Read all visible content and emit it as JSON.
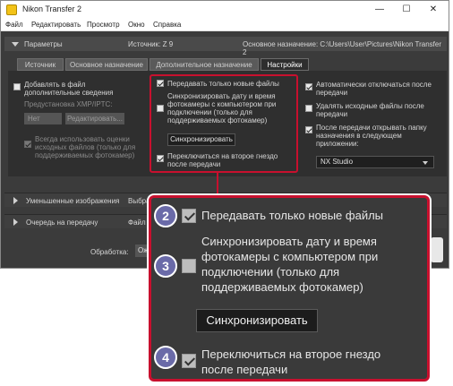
{
  "window": {
    "title": "Nikon Transfer 2",
    "minimize": "—",
    "maximize": "☐",
    "close": "✕"
  },
  "menu": [
    "Файл",
    "Редактировать",
    "Просмотр",
    "Окно",
    "Справка"
  ],
  "params": {
    "label": "Параметры",
    "source": "Источник: Z 9",
    "destination": "Основное назначение: C:\\Users\\User\\Pictures\\Nikon Transfer 2"
  },
  "tabs": [
    "Источник",
    "Основное назначение",
    "Дополнительное назначение",
    "Настройки"
  ],
  "settings": {
    "add_info": "Добавлять в файл дополнительные сведения",
    "xmp_preset": "Предустановка XMP/IPTC:",
    "xmp_value": "Нет",
    "edit_button": "Редактировать...",
    "always_use_rating": "Всегда использовать оценки исходных файлов (только для поддерживаемых фотокамер)",
    "only_new": "Передавать только новые файлы",
    "sync_datetime": "Синхронизировать дату и время фотокамеры с компьютером при подключении (только для поддерживаемых фотокамер)",
    "sync_button": "Синхронизировать",
    "switch_slot": "Переключиться на второе гнездо после передачи",
    "auto_disconnect": "Автоматически отключаться после передачи",
    "delete_originals": "Удалять исходные файлы после передачи",
    "open_folder": "После передачи открывать папку назначения в следующем приложении:",
    "app_value": "NX Studio"
  },
  "sections": {
    "thumbnails": "Уменьшенные изображения",
    "thumbnails_tail": "Выбра",
    "queue": "Очередь на передачу",
    "queue_tail": "Файл"
  },
  "processing": {
    "label": "Обработка:",
    "value": "Ож"
  },
  "callouts": {
    "badge2": "2",
    "badge3": "3",
    "badge4": "4",
    "only_new": "Передавать только новые файлы",
    "sync_datetime": "Синхронизировать дату и время фотокамеры с компьютером при подключении (только для поддерживаемых фотокамер)",
    "sync_button": "Синхронизировать",
    "switch_slot": "Переключиться на второе гнездо после передачи"
  },
  "colors": {
    "highlight": "#c8102e",
    "badge": "#6a6aa8",
    "panel_bg": "#3b3b3b"
  },
  "state": {
    "add_info": false,
    "always_use_rating": true,
    "only_new": true,
    "sync_datetime": false,
    "switch_slot": true,
    "auto_disconnect": true,
    "delete_originals": false,
    "open_folder": true
  }
}
